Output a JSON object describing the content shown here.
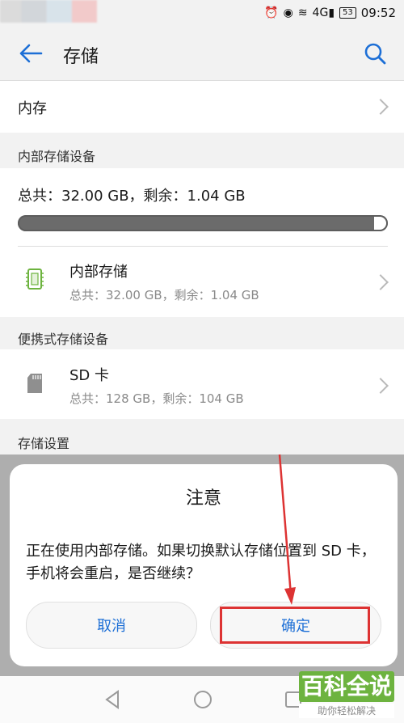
{
  "status": {
    "time": "09:52",
    "battery": "53",
    "network": "4G"
  },
  "header": {
    "title": "存储"
  },
  "memory": {
    "label": "内存"
  },
  "internal_section": {
    "title": "内部存储设备",
    "summary": "总共：32.00 GB，剩余：1.04 GB",
    "usage_ratio": 0.9675,
    "item": {
      "title": "内部存储",
      "subtitle": "总共：32.00 GB，剩余：1.04 GB"
    }
  },
  "portable_section": {
    "title": "便携式存储设备",
    "item": {
      "title": "SD 卡",
      "subtitle": "总共：128 GB，剩余：104 GB"
    }
  },
  "settings_section": {
    "title": "存储设置"
  },
  "dialog": {
    "title": "注意",
    "message": "正在使用内部存储。如果切换默认存储位置到 SD 卡，手机将会重启，是否继续？",
    "cancel_label": "取消",
    "confirm_label": "确定"
  },
  "watermark": {
    "top": "百科全说",
    "bottom": "助你轻松解决"
  },
  "colors": {
    "accent": "#1d6fd6",
    "highlight": "#d33333",
    "chip_green": "#6db33f"
  }
}
